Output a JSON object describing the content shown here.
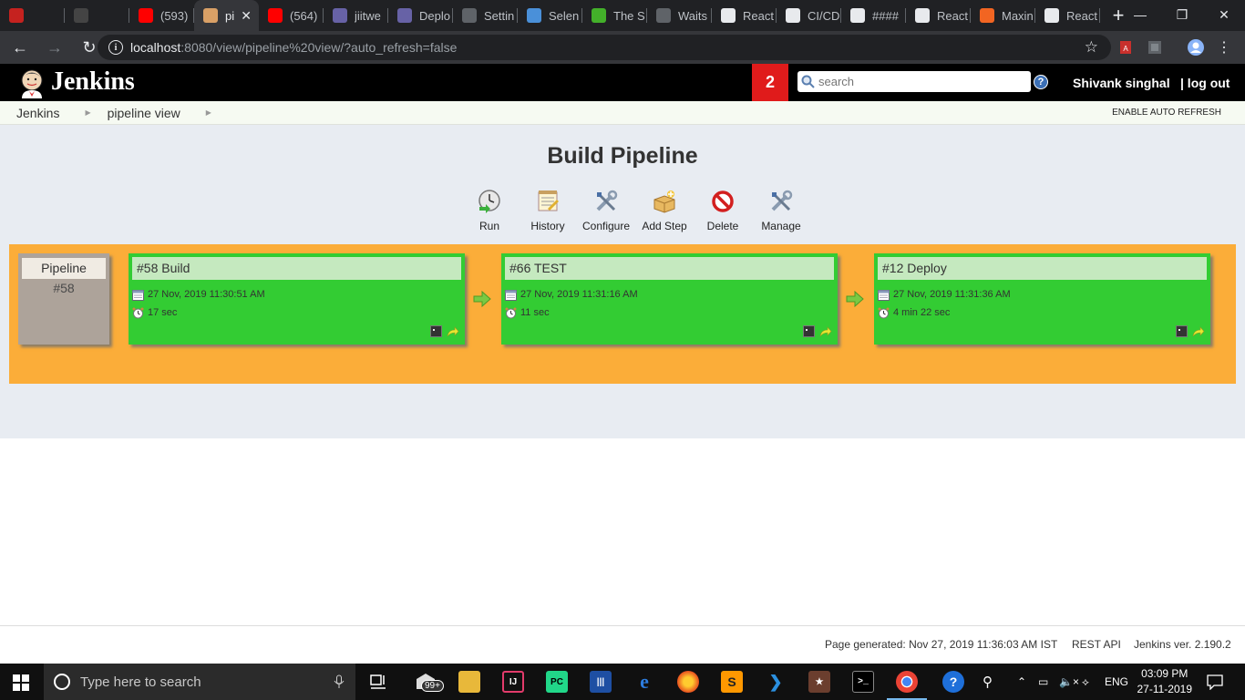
{
  "browser": {
    "tabs": [
      {
        "label": "",
        "icon": "gmail-icon",
        "color": "#c5221f"
      },
      {
        "label": "",
        "icon": "github-icon",
        "color": "#444444"
      },
      {
        "label": "(593)",
        "icon": "youtube-icon",
        "color": "#ff0000"
      },
      {
        "label": "pi",
        "icon": "jenkins-icon",
        "color": "#d9a066",
        "active": true
      },
      {
        "label": "(564)",
        "icon": "youtube-icon",
        "color": "#ff0000"
      },
      {
        "label": "jiitwe",
        "icon": "heroku-icon",
        "color": "#6762a6"
      },
      {
        "label": "Deplo",
        "icon": "heroku-icon",
        "color": "#6762a6"
      },
      {
        "label": "Settin",
        "icon": "settings-icon",
        "color": "#5f6368"
      },
      {
        "label": "Selen",
        "icon": "selenium-icon",
        "color": "#4a90d9"
      },
      {
        "label": "The S",
        "icon": "selenium-se-icon",
        "color": "#43b02a"
      },
      {
        "label": "Waits",
        "icon": "settings-icon",
        "color": "#5f6368"
      },
      {
        "label": "React",
        "icon": "globe-icon",
        "color": "#e8eaed"
      },
      {
        "label": "CI/CD",
        "icon": "cicd-icon",
        "color": "#e8eaed"
      },
      {
        "label": "####",
        "icon": "globe-icon",
        "color": "#e8eaed"
      },
      {
        "label": "React",
        "icon": "globe-icon",
        "color": "#e8eaed"
      },
      {
        "label": "Maxin",
        "icon": "gatsby-icon",
        "color": "#f26522"
      },
      {
        "label": "React",
        "icon": "globe-icon",
        "color": "#e8eaed"
      }
    ],
    "url_host": "localhost",
    "url_path": ":8080/view/pipeline%20view/?auto_refresh=false"
  },
  "header": {
    "title": "Jenkins",
    "notifications": "2",
    "search_placeholder": "search",
    "help": "?",
    "user": "Shivank singhal",
    "logout": "| log out"
  },
  "breadcrumb": {
    "items": [
      "Jenkins",
      "pipeline view"
    ],
    "auto_refresh": "ENABLE AUTO REFRESH"
  },
  "page": {
    "title": "Build Pipeline",
    "actions": [
      {
        "label": "Run",
        "icon": "run-clock-icon"
      },
      {
        "label": "History",
        "icon": "notepad-icon"
      },
      {
        "label": "Configure",
        "icon": "wrench-screwdriver-icon"
      },
      {
        "label": "Add Step",
        "icon": "package-add-icon"
      },
      {
        "label": "Delete",
        "icon": "no-entry-icon"
      },
      {
        "label": "Manage",
        "icon": "wrench-screwdriver-icon"
      }
    ]
  },
  "pipeline": {
    "label": "Pipeline",
    "number": "#58",
    "stages": [
      {
        "title": "#58 Build",
        "date": "27 Nov, 2019 11:30:51 AM",
        "duration": "17 sec",
        "status_color": "#33cc33"
      },
      {
        "title": "#66 TEST",
        "date": "27 Nov, 2019 11:31:16 AM",
        "duration": "11 sec",
        "status_color": "#33cc33"
      },
      {
        "title": "#12 Deploy",
        "date": "27 Nov, 2019 11:31:36 AM",
        "duration": "4 min 22 sec",
        "status_color": "#33cc33"
      }
    ]
  },
  "footer": {
    "generated": "Page generated: Nov 27, 2019 11:36:03 AM IST",
    "rest_api": "REST API",
    "version": "Jenkins ver. 2.190.2"
  },
  "taskbar": {
    "search_placeholder": "Type here to search",
    "badge": "99+",
    "language": "ENG",
    "time": "03:09 PM",
    "date": "27-11-2019"
  }
}
